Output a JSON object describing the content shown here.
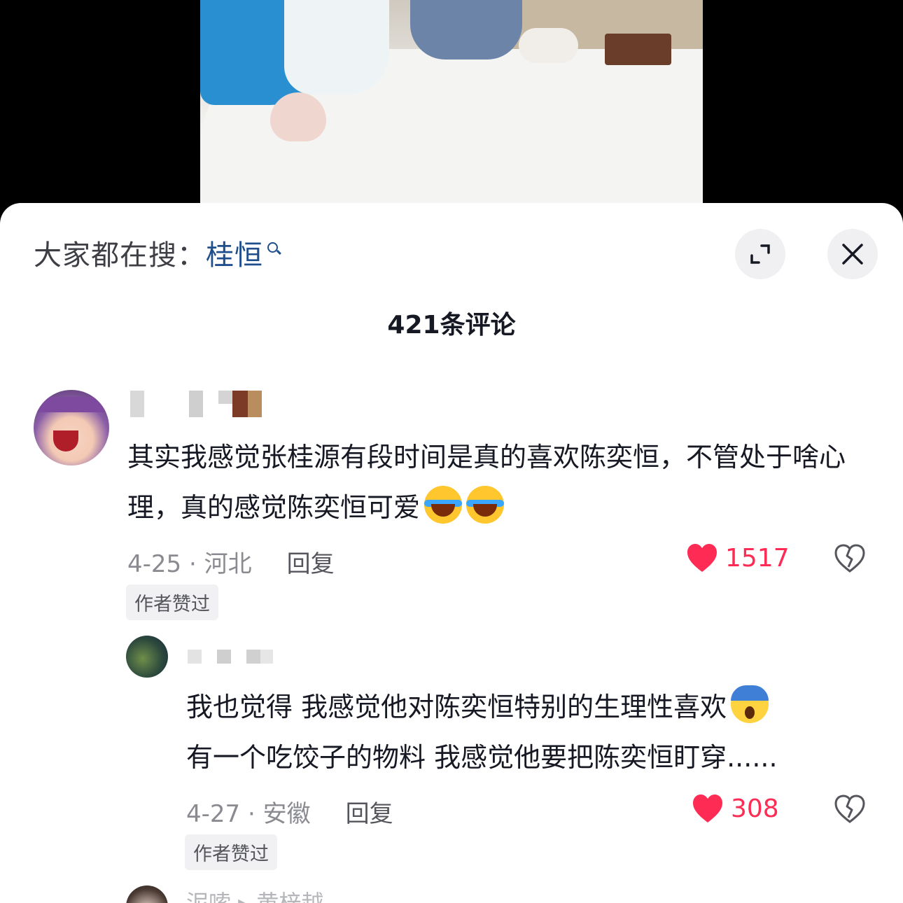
{
  "header": {
    "hot_search_prefix": "大家都在搜：",
    "hot_search_term": "桂恒",
    "comment_count_title": "421条评论"
  },
  "comments": [
    {
      "text": "其实我感觉张桂源有段时间是真的喜欢陈奕恒，不管处于啥心理，真的感觉陈奕恒可爱",
      "emojis": [
        "laughing-crying-emoji",
        "laughing-crying-emoji"
      ],
      "date_location": "4-25 · 河北",
      "reply_label": "回复",
      "likes": "1517",
      "badge": "作者赞过"
    },
    {
      "text": "我也觉得 我感觉他对陈奕恒特别的生理性喜欢",
      "text_line2": "有一个吃饺子的物料 我感觉他要把陈奕恒盯穿......",
      "emojis": [
        "screaming-emoji"
      ],
      "date_location": "4-27 · 安徽",
      "reply_label": "回复",
      "likes": "308",
      "badge": "作者赞过"
    }
  ],
  "next_comment_preview": "泥嗦 ▸ 黄梓越",
  "colors": {
    "like_red": "#fe2c55",
    "hot_search_blue": "#1f4e8c",
    "sheet_bg": "#ffffff"
  },
  "icons": [
    "expand-icon",
    "close-icon",
    "heart-icon",
    "dislike-icon",
    "search-icon"
  ]
}
